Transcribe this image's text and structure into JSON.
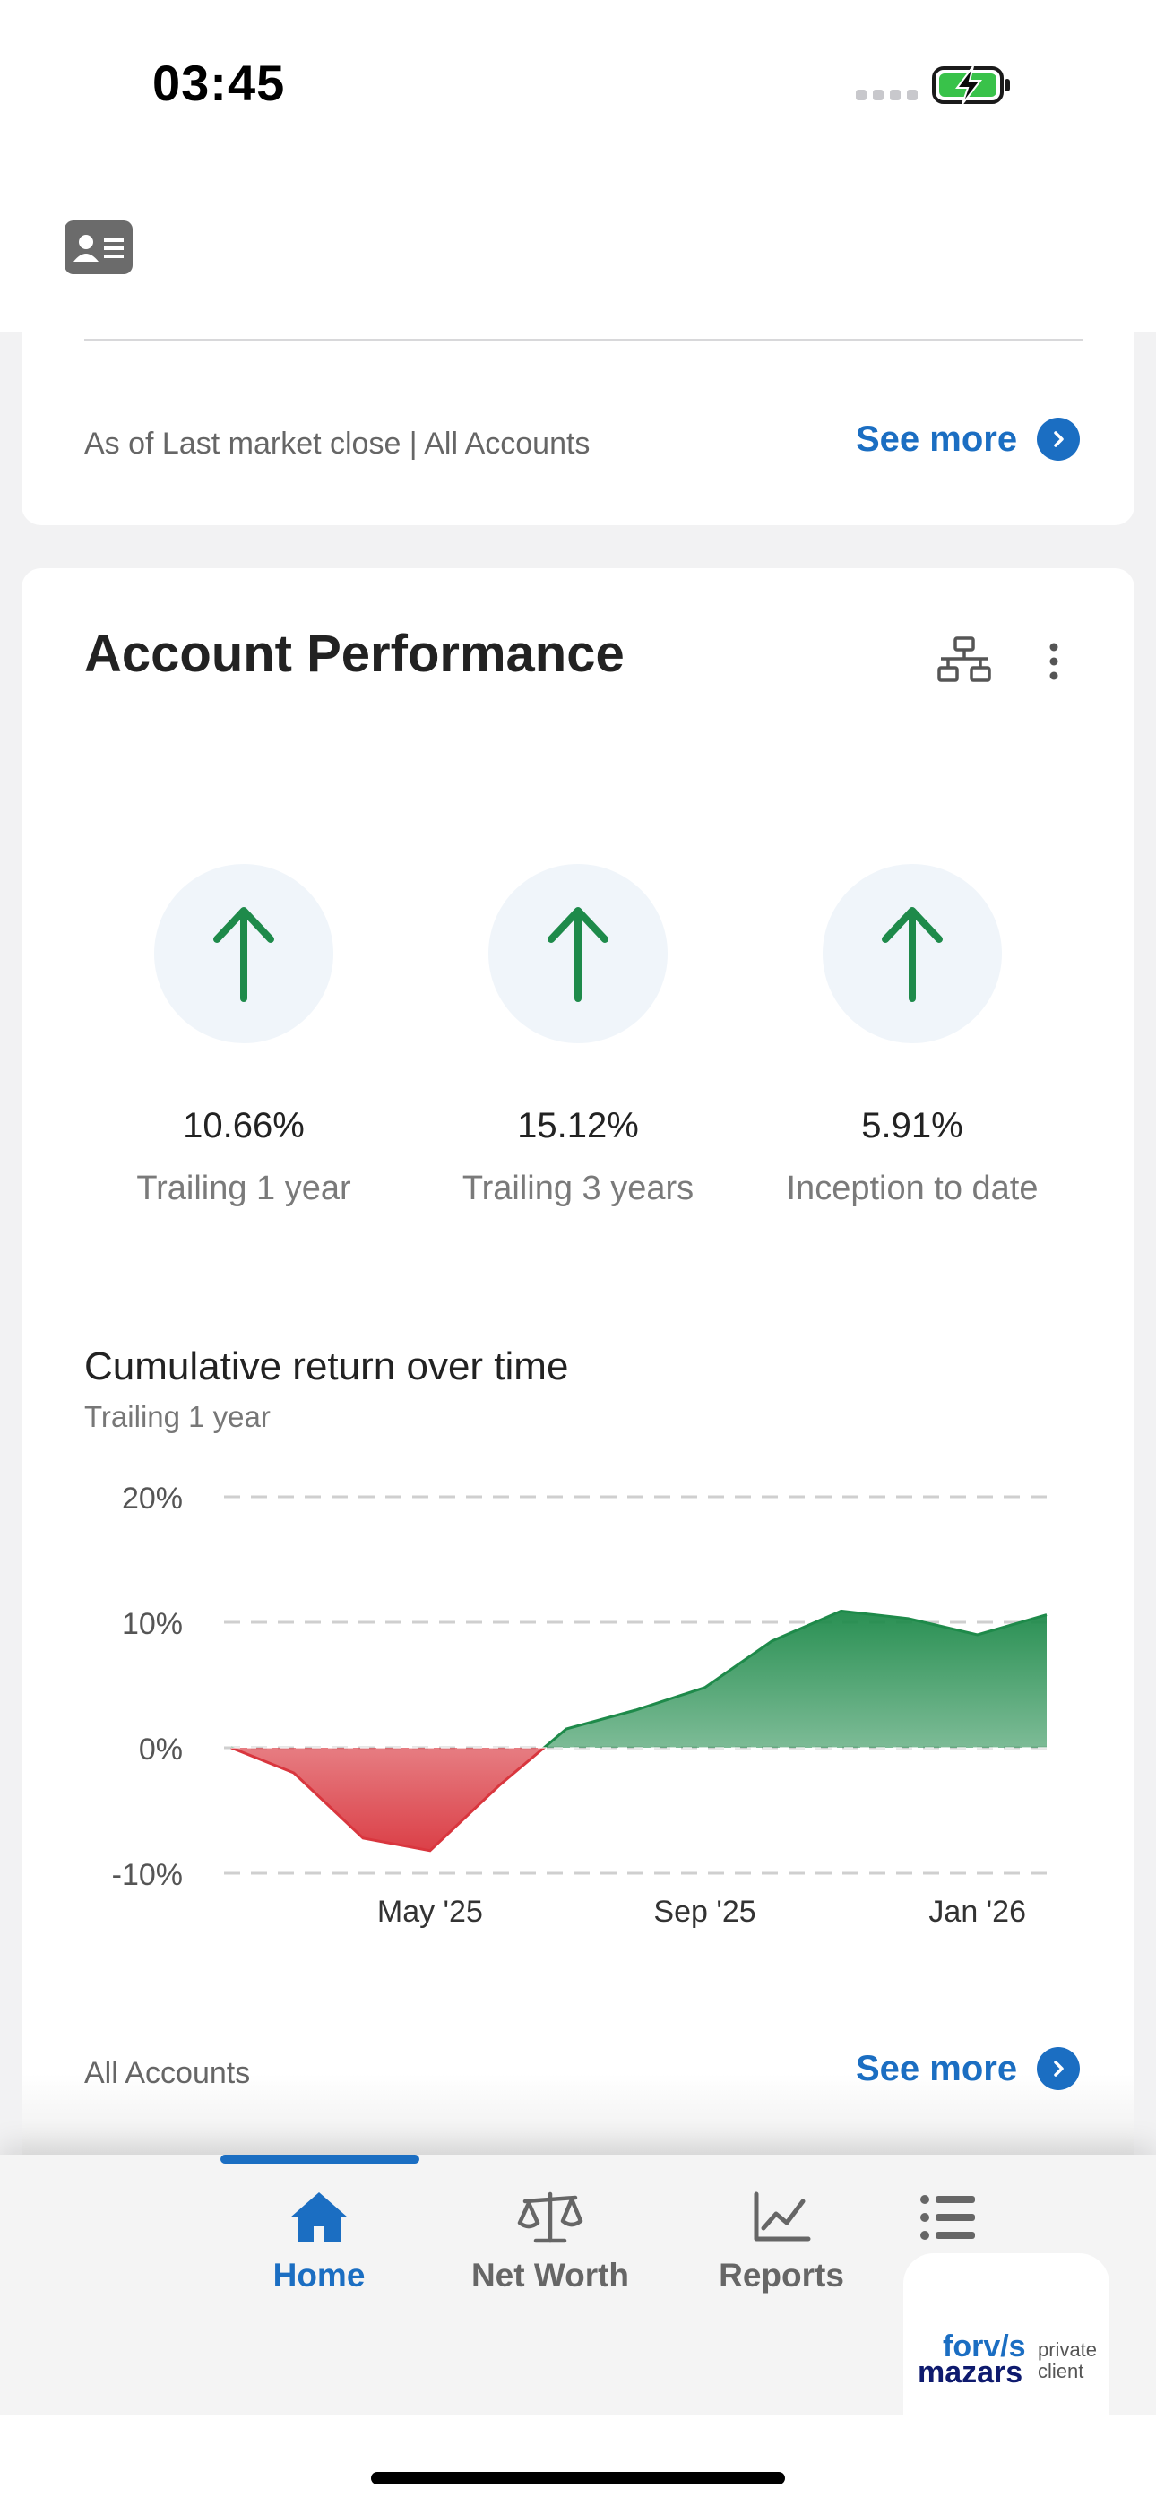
{
  "status_bar": {
    "time": "03:45"
  },
  "summary_card": {
    "meta": "As of Last market close | All Accounts",
    "see_more": "See more"
  },
  "performance": {
    "title": "Account Performance",
    "metrics": [
      {
        "value": "10.66%",
        "label": "Trailing 1 year",
        "trend": "up"
      },
      {
        "value": "15.12%",
        "label": "Trailing 3 years",
        "trend": "up"
      },
      {
        "value": "5.91%",
        "label": "Inception to date",
        "trend": "up"
      }
    ],
    "chart_title": "Cumulative return over time",
    "chart_subtitle": "Trailing 1 year",
    "footer": "All Accounts",
    "see_more": "See more"
  },
  "chart_data": {
    "type": "area",
    "title": "Cumulative return over time",
    "subtitle": "Trailing 1 year",
    "y_tick_labels": [
      "20%",
      "10%",
      "0%",
      "-10%"
    ],
    "x_tick_labels": [
      "May '25",
      "Sep '25",
      "Jan '26"
    ],
    "ylim": [
      -10,
      20
    ],
    "xlim": [
      "2025-02-01",
      "2026-02-01"
    ],
    "grid": true,
    "positive_color": "#1e8a4a",
    "negative_color": "#d9363e",
    "points": [
      {
        "x": "2025-02-01",
        "y": 0.0
      },
      {
        "x": "2025-03-01",
        "y": -2.0
      },
      {
        "x": "2025-04-01",
        "y": -7.2
      },
      {
        "x": "2025-05-01",
        "y": -8.2
      },
      {
        "x": "2025-06-01",
        "y": -3.0
      },
      {
        "x": "2025-07-01",
        "y": 1.5
      },
      {
        "x": "2025-08-01",
        "y": 3.0
      },
      {
        "x": "2025-09-01",
        "y": 4.8
      },
      {
        "x": "2025-10-01",
        "y": 8.5
      },
      {
        "x": "2025-11-01",
        "y": 10.9
      },
      {
        "x": "2025-12-01",
        "y": 10.3
      },
      {
        "x": "2026-01-01",
        "y": 9.0
      },
      {
        "x": "2026-02-01",
        "y": 10.6
      }
    ]
  },
  "tabs": [
    {
      "label": "Home",
      "icon": "home-icon",
      "active": true
    },
    {
      "label": "Net Worth",
      "icon": "scale-icon",
      "active": false
    },
    {
      "label": "Reports",
      "icon": "line-chart-icon",
      "active": false
    },
    {
      "label": "",
      "icon": "list-icon",
      "active": false
    }
  ],
  "brand": {
    "line1": "forv/s",
    "line2": "mazars",
    "line3": "private client"
  },
  "colors": {
    "accent": "#1b6ec2",
    "up_arrow": "#1e8a4a"
  }
}
